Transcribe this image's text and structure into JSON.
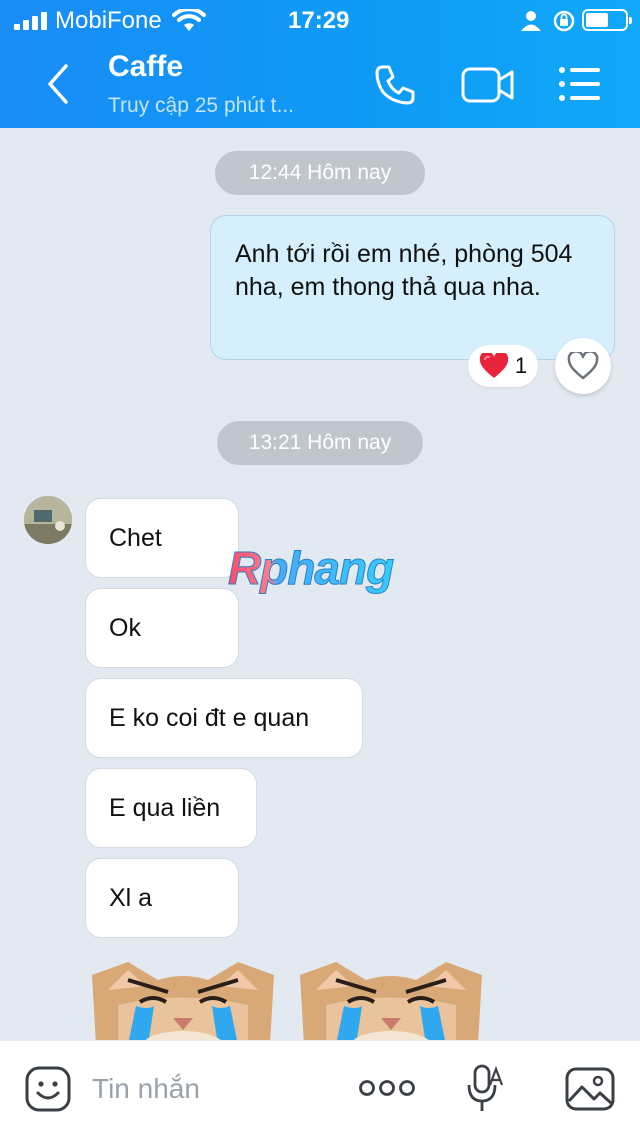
{
  "status_bar": {
    "carrier": "MobiFone",
    "time": "17:29"
  },
  "header": {
    "title": "Caffe",
    "subtitle": "Truy cập 25 phút t..."
  },
  "messages": {
    "timestamp_1": "12:44 Hôm nay",
    "outgoing_text": "Anh tới rồi em nhé, phòng 504 nha, em thong thả qua nha.",
    "reaction_count": "1",
    "timestamp_2": "13:21 Hôm nay",
    "incoming": [
      "Chet",
      "Ok",
      "E ko coi đt e quan",
      "E qua liền",
      "Xl a"
    ]
  },
  "watermark": "Rphang",
  "input_bar": {
    "placeholder": "Tin nhắn"
  },
  "colors": {
    "header_gradient_start": "#1a8cf7",
    "header_gradient_end": "#10a8f8",
    "chat_background": "#e2e9f1",
    "outgoing_bubble": "#d5effc",
    "incoming_bubble": "#ffffff",
    "timestamp_pill": "#bfc6ce",
    "reaction_heart": "#e8243a"
  },
  "icons": {
    "back": "chevron-left-icon",
    "call": "phone-icon",
    "video": "video-camera-icon",
    "menu": "list-icon",
    "sticker": "emoji-icon",
    "more": "dots-icon",
    "voice": "microphone-icon",
    "image": "image-icon",
    "like": "heart-outline-icon"
  }
}
